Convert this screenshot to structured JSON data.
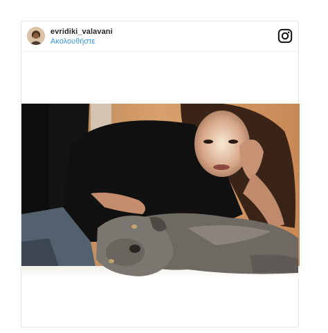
{
  "post": {
    "username": "evridiki_valavani",
    "follow_label": "Ακολουθήστε"
  },
  "icons": {
    "header_icon": "instagram-icon",
    "avatar": "profile-photo"
  },
  "colors": {
    "link": "#3897f0",
    "username": "#262626",
    "border": "#e3e3e3"
  }
}
